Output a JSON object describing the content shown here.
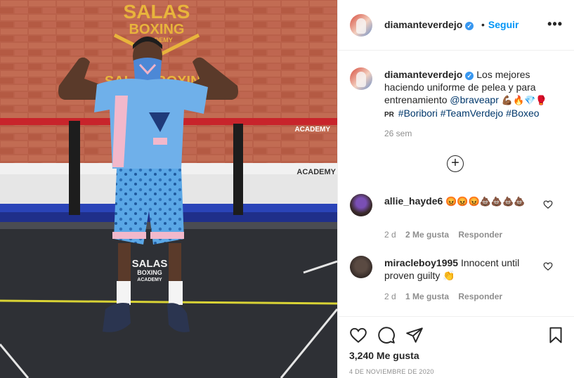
{
  "photo": {
    "wall_sign_top": "SALAS",
    "wall_sign_mid": "BOXING",
    "wall_sign_small": "ACADEMY",
    "wall_sign_row": "SALAS BOXING",
    "rope_text": "ACADEMY",
    "floor_logo_top": "SALAS",
    "floor_logo_mid": "BOXING",
    "floor_logo_bottom": "ACADEMY"
  },
  "header": {
    "username": "diamanteverdejo",
    "follow_label": "Seguir",
    "more_label": "•••",
    "verified_icon": "verified-badge-icon"
  },
  "caption": {
    "username": "diamanteverdejo",
    "text_before": "Los mejores haciendo uniforme de pelea y para entrenamiento",
    "mention": "@braveapr",
    "emojis": "💪🏾🔥💎🥊",
    "country_label": "PR",
    "hashtags": "#Boribori #TeamVerdejo #Boxeo",
    "time": "26 sem"
  },
  "load_more_label": "+",
  "comments": [
    {
      "username": "allie_hayde6",
      "text": "😡😡😡💩💩💩💩",
      "age": "2 d",
      "likes": "2 Me gusta",
      "reply": "Responder"
    },
    {
      "username": "miracleboy1995",
      "text": "Innocent until proven guilty 👏",
      "age": "2 d",
      "likes": "1 Me gusta",
      "reply": "Responder"
    }
  ],
  "actions": {
    "like_icon": "heart-icon",
    "comment_icon": "comment-icon",
    "share_icon": "share-icon",
    "save_icon": "bookmark-icon"
  },
  "likes_count": "3,240 Me gusta",
  "post_date": "4 DE NOVIEMBRE DE 2020",
  "colors": {
    "accent": "#0095f6",
    "verified": "#3897f0",
    "text": "#262626",
    "muted": "#8e8e8e",
    "link": "#00376b"
  }
}
